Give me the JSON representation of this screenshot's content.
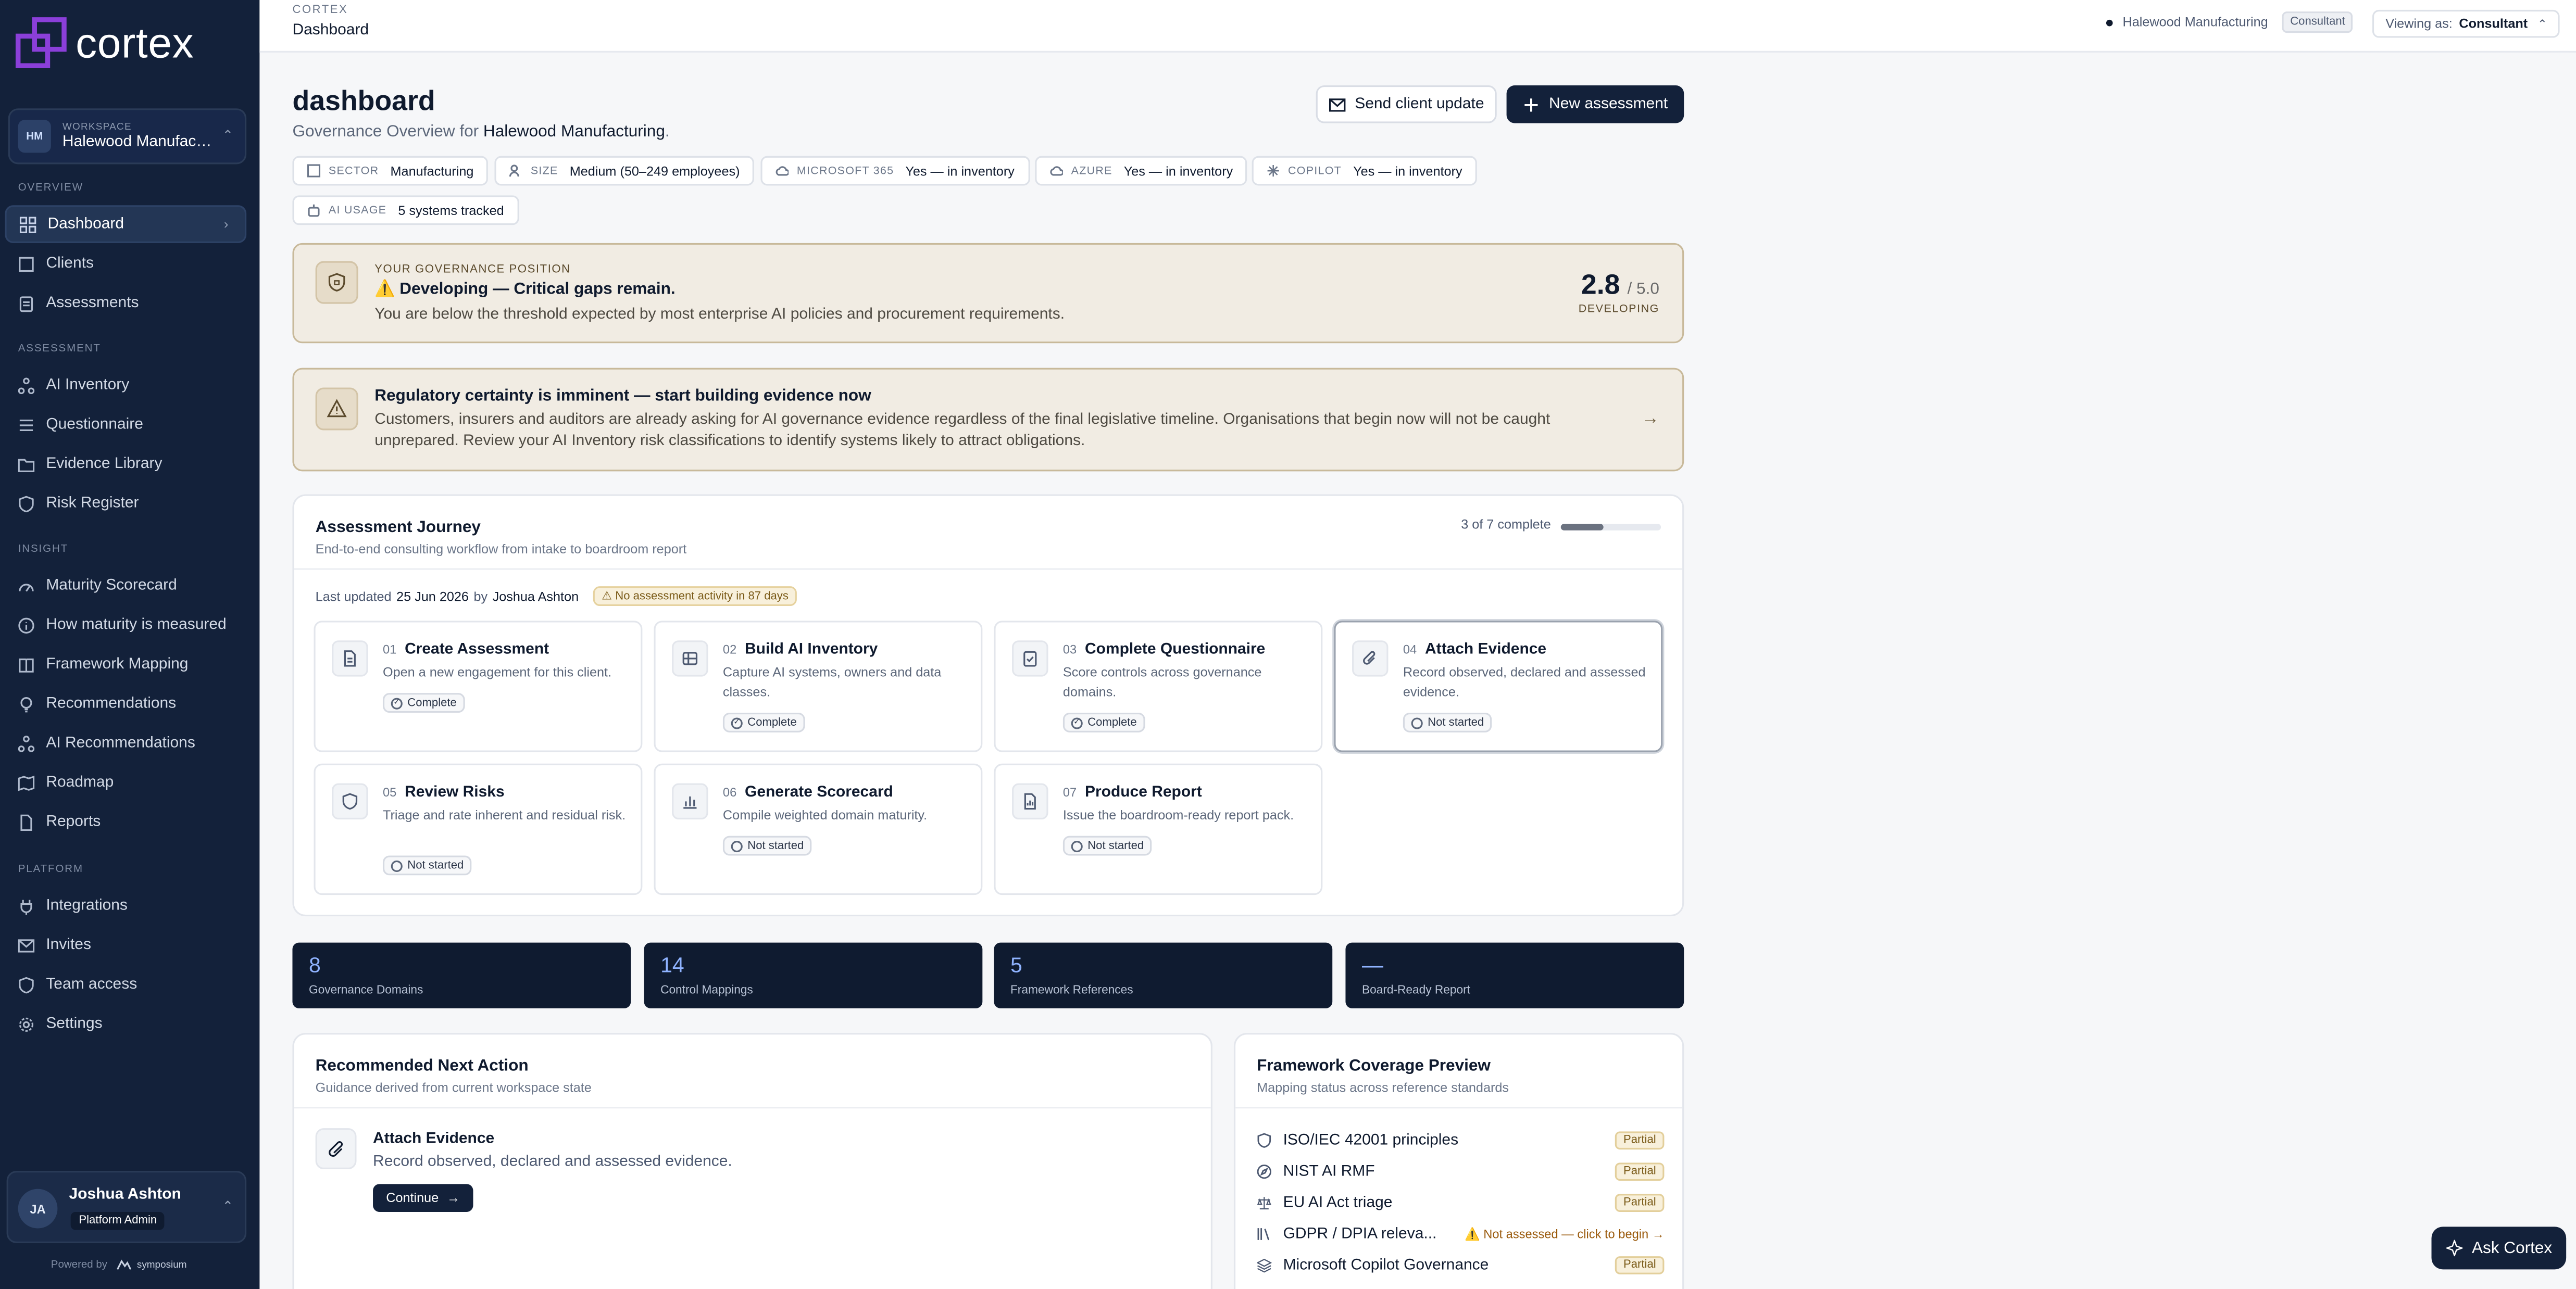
{
  "sidebar": {
    "logo": "cortex",
    "workspace_label": "WORKSPACE",
    "workspace_initials": "HM",
    "workspace_name": "Halewood Manufacturing",
    "sections": {
      "overview": "OVERVIEW",
      "assessment": "ASSESSMENT",
      "insight": "INSIGHT",
      "platform": "PLATFORM"
    },
    "items": {
      "dashboard": "Dashboard",
      "clients": "Clients",
      "assessments": "Assessments",
      "ai_inventory": "AI Inventory",
      "questionnaire": "Questionnaire",
      "evidence_library": "Evidence Library",
      "risk_register": "Risk Register",
      "maturity_scorecard": "Maturity Scorecard",
      "how_maturity": "How maturity is measured",
      "framework_mapping": "Framework Mapping",
      "recommendations": "Recommendations",
      "ai_recommendations": "AI Recommendations",
      "roadmap": "Roadmap",
      "reports": "Reports",
      "integrations": "Integrations",
      "invites": "Invites",
      "team_access": "Team access",
      "settings": "Settings"
    },
    "user": {
      "initials": "JA",
      "name": "Joshua Ashton",
      "role": "Platform Admin"
    },
    "powered_by": "Powered by",
    "powered_brand": "symposium"
  },
  "topbar": {
    "crumb_top": "CORTEX",
    "crumb_main": "Dashboard",
    "org": "Halewood Manufacturing",
    "badge": "Consultant",
    "viewing_label": "Viewing as:",
    "viewing_value": "Consultant"
  },
  "header": {
    "title": "dashboard",
    "subtitle_prefix": "Governance Overview for ",
    "subtitle_org": "Halewood Manufacturing",
    "subtitle_suffix": ".",
    "send_update": "Send client update",
    "new_assessment": "New assessment"
  },
  "chips": [
    {
      "key": "SECTOR",
      "value": "Manufacturing"
    },
    {
      "key": "SIZE",
      "value": "Medium (50–249 employees)"
    },
    {
      "key": "MICROSOFT 365",
      "value": "Yes — in inventory"
    },
    {
      "key": "AZURE",
      "value": "Yes — in inventory"
    },
    {
      "key": "COPILOT",
      "value": "Yes — in inventory"
    },
    {
      "key": "AI USAGE",
      "value": "5 systems tracked"
    }
  ],
  "position": {
    "label": "YOUR GOVERNANCE POSITION",
    "title": "⚠️ Developing — Critical gaps remain.",
    "text": "You are below the threshold expected by most enterprise AI policies and procurement requirements.",
    "score": "2.8",
    "score_max": "/ 5.0",
    "level": "DEVELOPING"
  },
  "regulatory": {
    "title": "Regulatory certainty is imminent — start building evidence now",
    "text": "Customers, insurers and auditors are already asking for AI governance evidence regardless of the final legislative timeline. Organisations that begin now will not be caught unprepared. Review your AI Inventory risk classifications to identify systems likely to attract obligations."
  },
  "journey": {
    "title": "Assessment Journey",
    "subtitle": "End-to-end consulting workflow from intake to boardroom report",
    "progress_text": "3 of 7 complete",
    "progress": 0.43,
    "last_updated_label": "Last updated",
    "last_updated_date": "25 Jun 2026",
    "by": "by",
    "last_updated_user": "Joshua Ashton",
    "warning": "No assessment activity in 87 days",
    "steps": [
      {
        "num": "01",
        "title": "Create Assessment",
        "desc": "Open a new engagement for this client.",
        "status": "Complete",
        "icon": "document-icon"
      },
      {
        "num": "02",
        "title": "Build AI Inventory",
        "desc": "Capture AI systems, owners and data classes.",
        "status": "Complete",
        "icon": "database-icon"
      },
      {
        "num": "03",
        "title": "Complete Questionnaire",
        "desc": "Score controls across governance domains.",
        "status": "Complete",
        "icon": "clipboard-icon"
      },
      {
        "num": "04",
        "title": "Attach Evidence",
        "desc": "Record observed, declared and assessed evidence.",
        "status": "Not started",
        "icon": "paperclip-icon"
      },
      {
        "num": "05",
        "title": "Review Risks",
        "desc": "Triage and rate inherent and residual risk.",
        "status": "Not started",
        "icon": "shield-icon"
      },
      {
        "num": "06",
        "title": "Generate Scorecard",
        "desc": "Compile weighted domain maturity.",
        "status": "Not started",
        "icon": "bar-chart-icon"
      },
      {
        "num": "07",
        "title": "Produce Report",
        "desc": "Issue the boardroom-ready report pack.",
        "status": "Not started",
        "icon": "report-icon"
      }
    ]
  },
  "stats": [
    {
      "value": "8",
      "label": "Governance Domains"
    },
    {
      "value": "14",
      "label": "Control Mappings"
    },
    {
      "value": "5",
      "label": "Framework References"
    },
    {
      "value": "—",
      "label": "Board-Ready Report"
    }
  ],
  "next_action": {
    "title": "Recommended Next Action",
    "subtitle": "Guidance derived from current workspace state",
    "item_title": "Attach Evidence",
    "item_desc": "Record observed, declared and assessed evidence.",
    "button": "Continue"
  },
  "framework": {
    "title": "Framework Coverage Preview",
    "subtitle": "Mapping status across reference standards",
    "rows": [
      {
        "name": "ISO/IEC 42001 principles",
        "status": "Partial"
      },
      {
        "name": "NIST AI RMF",
        "status": "Partial"
      },
      {
        "name": "EU AI Act triage",
        "status": "Partial"
      },
      {
        "name": "GDPR / DPIA releva...",
        "status": "⚠️ Not assessed — click to begin →"
      },
      {
        "name": "Microsoft Copilot Governance",
        "status": "Partial"
      }
    ]
  },
  "ask_button": "Ask Cortex",
  "colors": {
    "sidebar": "#13213a",
    "accent_logo": "#7c3aed",
    "warning_bg": "#f1ece3",
    "stat_value": "#8fb3ff"
  }
}
